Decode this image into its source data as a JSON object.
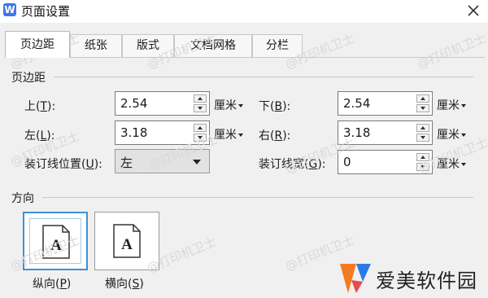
{
  "window": {
    "title": "页面设置",
    "app_icon_letter": "W"
  },
  "tabs": [
    {
      "label": "页边距",
      "active": true
    },
    {
      "label": "纸张",
      "active": false
    },
    {
      "label": "版式",
      "active": false
    },
    {
      "label": "文档网格",
      "active": false
    },
    {
      "label": "分栏",
      "active": false
    }
  ],
  "margins": {
    "section_title": "页边距",
    "top": {
      "label": "上(",
      "key": "T",
      "suffix": "):",
      "value": "2.54",
      "unit": "厘米"
    },
    "bottom": {
      "label": "下(",
      "key": "B",
      "suffix": "):",
      "value": "2.54",
      "unit": "厘米"
    },
    "left": {
      "label": "左(",
      "key": "L",
      "suffix": "):",
      "value": "3.18",
      "unit": "厘米"
    },
    "right": {
      "label": "右(",
      "key": "R",
      "suffix": "):",
      "value": "3.18",
      "unit": "厘米"
    },
    "gutter_position": {
      "label": "装订线位置(",
      "key": "U",
      "suffix": "):",
      "value": "左"
    },
    "gutter_width": {
      "label": "装订线宽(",
      "key": "G",
      "suffix": "):",
      "value": "0",
      "unit": "厘米"
    }
  },
  "orientation": {
    "section_title": "方向",
    "icon_letter": "A",
    "portrait": {
      "label": "纵向(",
      "key": "P",
      "suffix": ")",
      "selected": true
    },
    "landscape": {
      "label": "横向(",
      "key": "S",
      "suffix": ")",
      "selected": false
    }
  },
  "watermark": "@打印机卫士",
  "brand": {
    "name": "爱美软件园"
  },
  "colors": {
    "selection_blue": "#3c90d9",
    "app_blue": "#3b78e7",
    "brand_orange": "#f47a20",
    "brand_blue": "#2c7be5"
  }
}
